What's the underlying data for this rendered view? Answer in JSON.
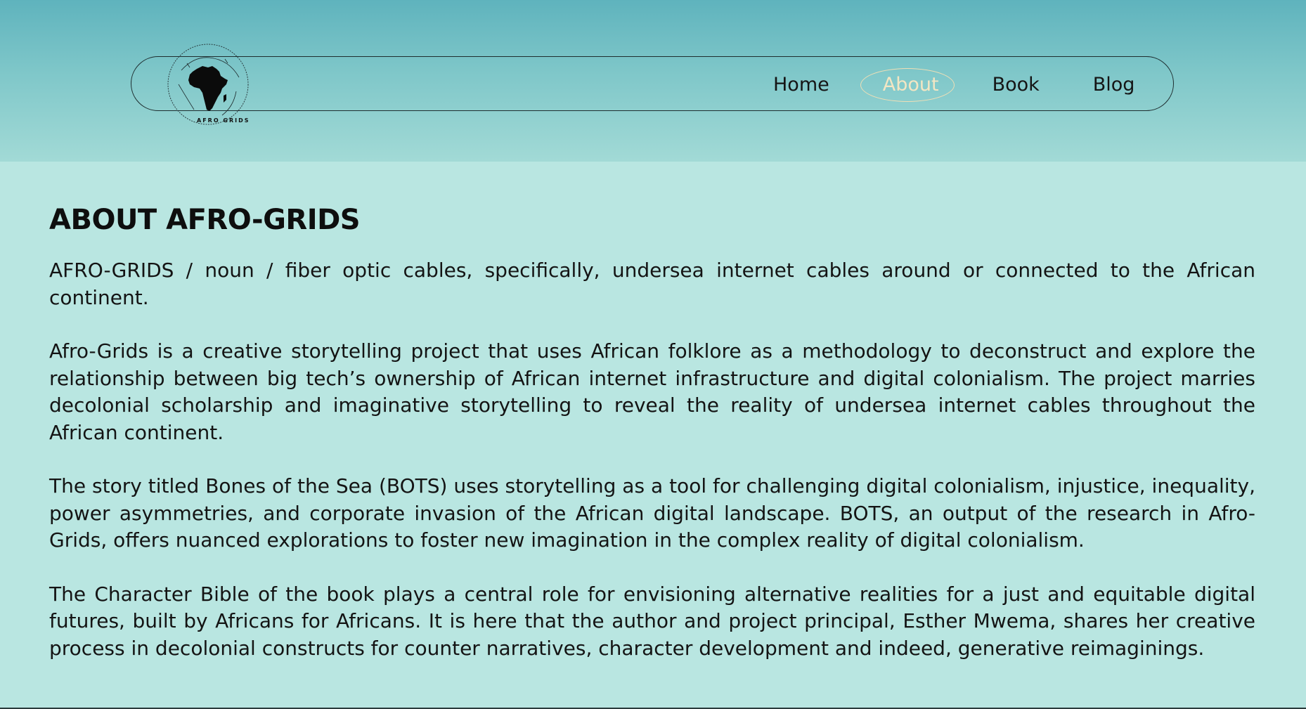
{
  "nav": {
    "links": [
      {
        "label": "Home",
        "active": false
      },
      {
        "label": "About",
        "active": true
      },
      {
        "label": "Book",
        "active": false
      },
      {
        "label": "Blog",
        "active": false
      }
    ]
  },
  "logo": {
    "text": "AFRO GRIDS",
    "icon": "africa-map-icon"
  },
  "main": {
    "title": "ABOUT AFRO-GRIDS",
    "paragraphs": [
      "AFRO-GRIDS / noun / fiber optic cables, specifically, undersea internet cables around or connected to the African continent.",
      "Afro-Grids is a creative storytelling project that uses African folklore as a methodology to deconstruct and explore the relationship between big tech’s ownership of African internet infrastructure and digital colonialism. The project marries decolonial scholarship and imaginative storytelling to reveal  the reality of undersea internet cables throughout the African continent.",
      "The story titled Bones of the Sea (BOTS) uses storytelling as a tool for challenging digital colonialism, injustice, inequality, power asymmetries, and corporate invasion of the African digital landscape. BOTS, an output of the research in Afro-Grids, offers nuanced explorations to foster new imagination in the complex reality of digital colonialism.",
      "The Character Bible of the book plays a central role for envisioning alternative realities for a just and equitable digital futures, built by Africans for Africans. It is here that the author and project principal, Esther Mwema, shares her creative process in decolonial constructs for counter narratives, character development and indeed, generative reimaginings."
    ]
  },
  "colors": {
    "header_top": "#5fb3bd",
    "page_bg": "#b9e6e1",
    "active_link": "#f3e6c3"
  }
}
